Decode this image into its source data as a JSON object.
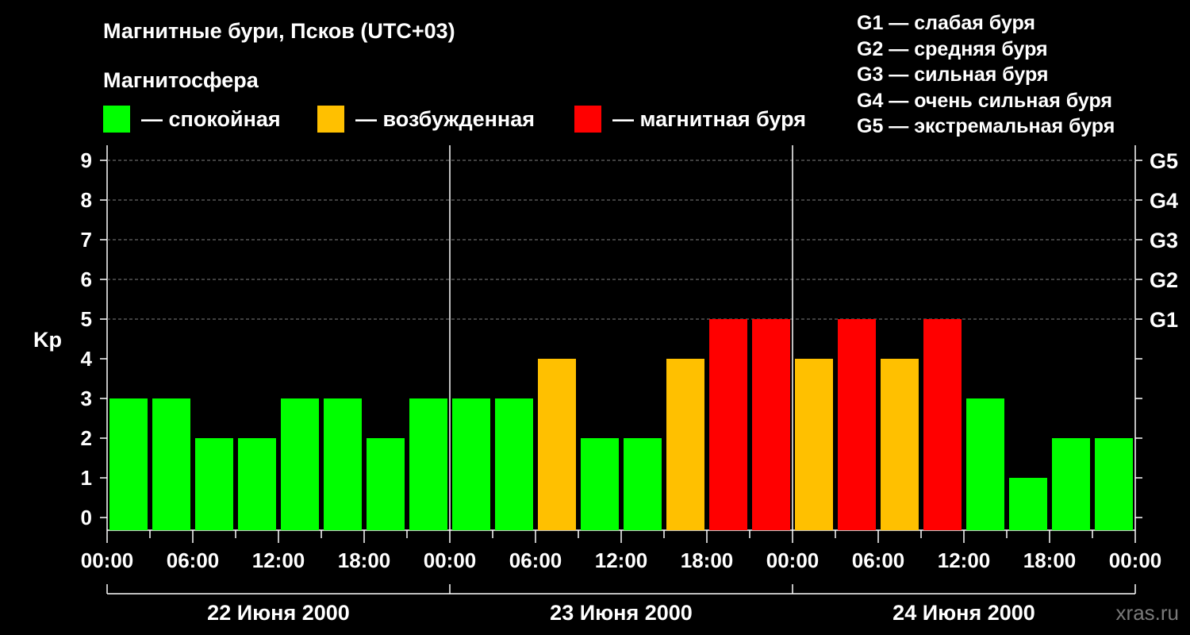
{
  "title": "Магнитные бури, Псков (UTC+03)",
  "subtitle": "Магнитосфера",
  "legend": [
    {
      "label": "— спокойная",
      "color": "#00ff00"
    },
    {
      "label": "— возбужденная",
      "color": "#ffc000"
    },
    {
      "label": "— магнитная буря",
      "color": "#ff0000"
    }
  ],
  "storm_levels": [
    "G1 — слабая буря",
    "G2 — средняя буря",
    "G3 — сильная буря",
    "G4 — очень сильная буря",
    "G5 — экстремальная буря"
  ],
  "watermark": "xras.ru",
  "chart_data": {
    "type": "bar",
    "ylabel": "Kp",
    "ylim": [
      0,
      9
    ],
    "yticks": [
      0,
      1,
      2,
      3,
      4,
      5,
      6,
      7,
      8,
      9
    ],
    "right_ticks": [
      {
        "value": 5,
        "label": "G1"
      },
      {
        "value": 6,
        "label": "G2"
      },
      {
        "value": 7,
        "label": "G3"
      },
      {
        "value": 8,
        "label": "G4"
      },
      {
        "value": 9,
        "label": "G5"
      }
    ],
    "dashed_gridlines_at": [
      5,
      6,
      7,
      8,
      9
    ],
    "x_tick_labels": [
      "00:00",
      "06:00",
      "12:00",
      "18:00",
      "00:00",
      "06:00",
      "12:00",
      "18:00",
      "00:00",
      "06:00",
      "12:00",
      "18:00",
      "00:00"
    ],
    "days": [
      "22 Июня 2000",
      "23 Июня 2000",
      "24 Июня 2000"
    ],
    "interval_hours": 3,
    "values": [
      3,
      3,
      2,
      2,
      3,
      3,
      2,
      3,
      3,
      3,
      4,
      2,
      2,
      4,
      5,
      5,
      4,
      5,
      4,
      5,
      3,
      1,
      2,
      2
    ],
    "color_rule": {
      "calm_max": 3,
      "active": 4,
      "storm_min": 5
    }
  }
}
